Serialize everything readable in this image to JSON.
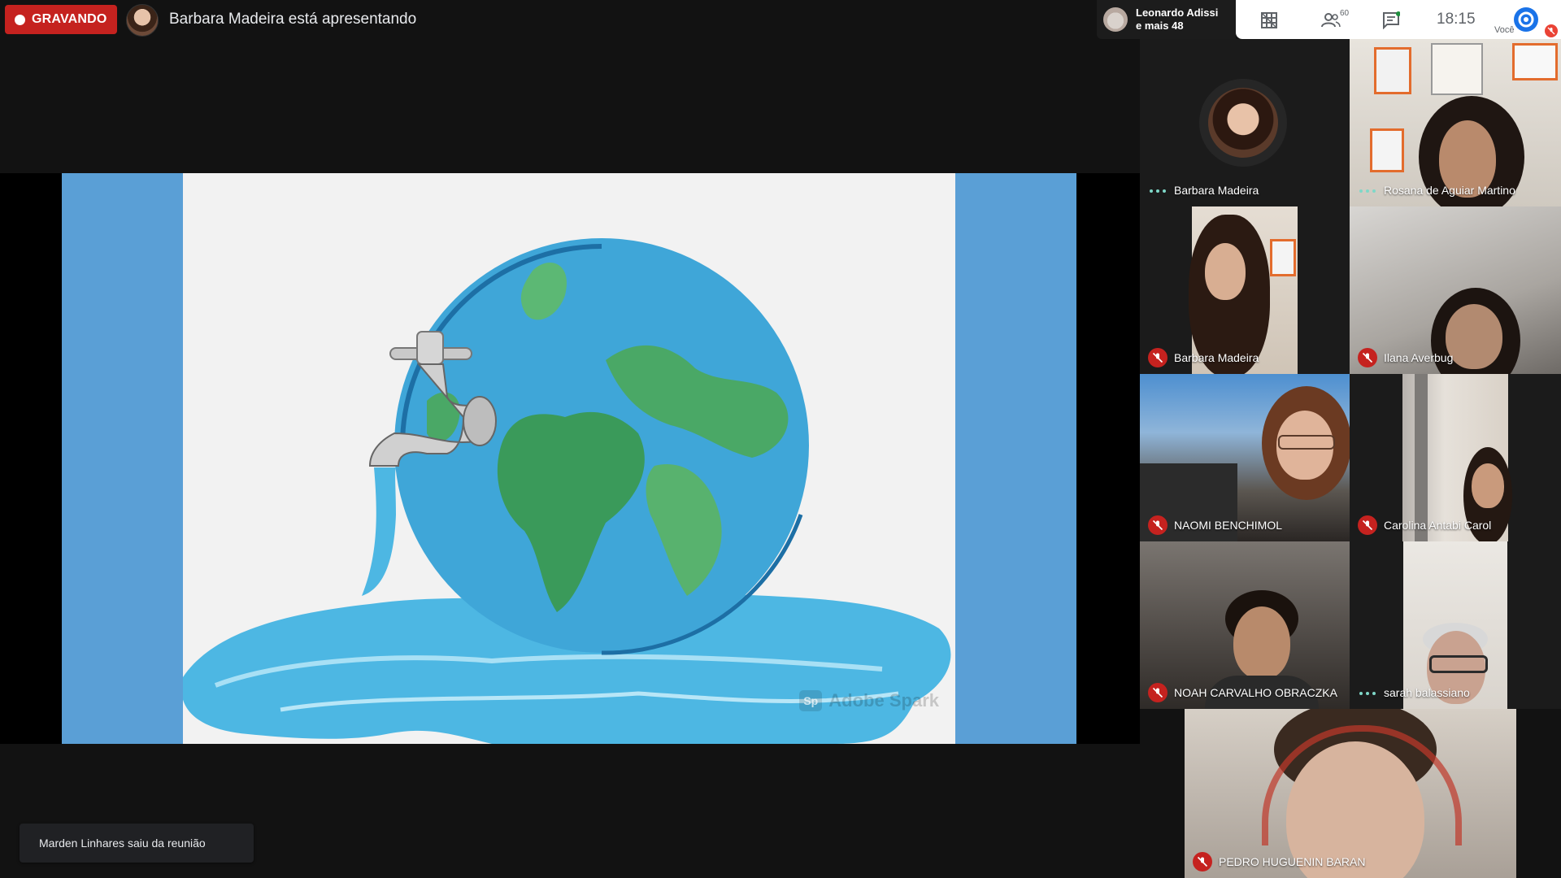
{
  "recording": {
    "label": "GRAVANDO"
  },
  "presenter": {
    "label": "Barbara Madeira está apresentando"
  },
  "others_chip": {
    "name": "Leonardo Adissi",
    "more": "e mais 48"
  },
  "toolbar": {
    "participants_count": "60",
    "time": "18:15",
    "you_label": "Você"
  },
  "slide": {
    "watermark_logo": "Sp",
    "watermark_text": "Adobe Spark"
  },
  "toast": {
    "message": "Marden Linhares saiu da reunião"
  },
  "participants": [
    {
      "name": "Barbara Madeira",
      "status": "speaking"
    },
    {
      "name": "Rosana de Aguiar Martino",
      "status": "speaking"
    },
    {
      "name": "Barbara Madeira",
      "status": "muted"
    },
    {
      "name": "Ilana Averbug",
      "status": "muted"
    },
    {
      "name": "NAOMI BENCHIMOL",
      "status": "muted"
    },
    {
      "name": "Carolina Antabi Carol",
      "status": "muted"
    },
    {
      "name": "NOAH CARVALHO OBRACZKA",
      "status": "muted"
    },
    {
      "name": "sarah balassiano",
      "status": "speaking"
    },
    {
      "name": "PEDRO HUGUENIN BARAN",
      "status": "muted"
    }
  ],
  "colors": {
    "background": "#121212",
    "recording_red": "#c5221f",
    "mic_off_red": "#c5221f",
    "talk_dots": "#7fd8c8",
    "slide_blue": "#5a9fd6",
    "accent_blue": "#1a73e8"
  }
}
